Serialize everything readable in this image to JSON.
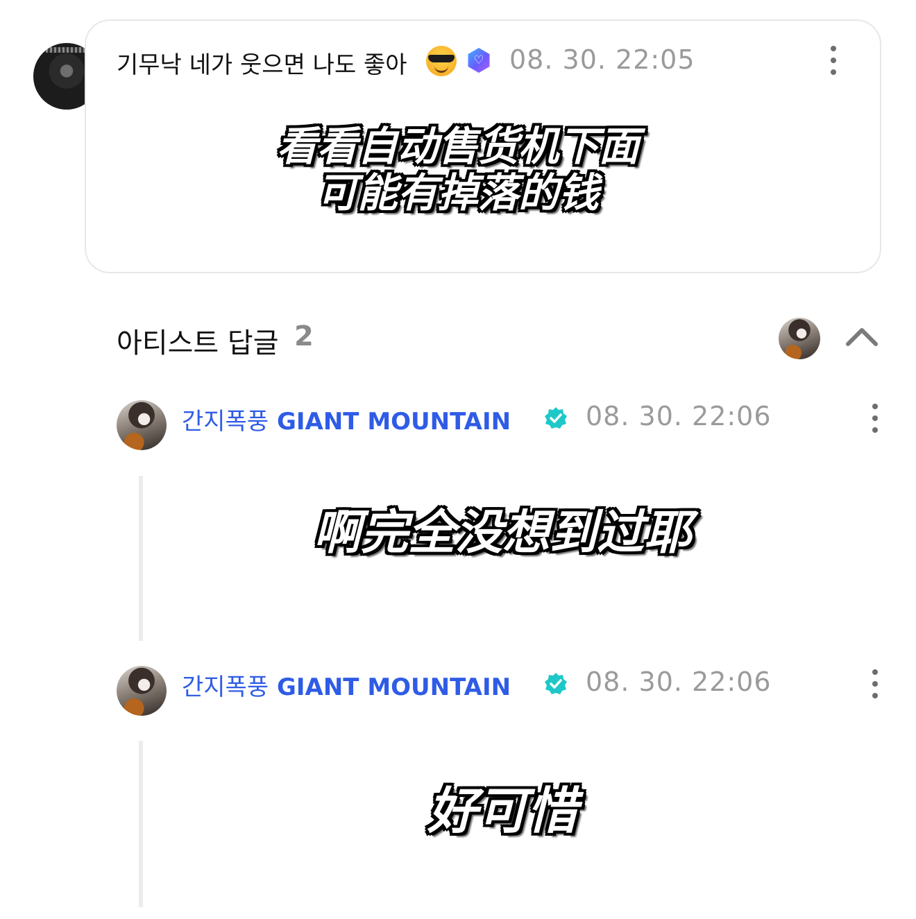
{
  "post": {
    "author": "기무낙 네가 웃으면 나도 좋아",
    "emoji_icon": "smiling-face-with-sunglasses",
    "badge_icon": "fan-verified-hex-badge",
    "timestamp": "08. 30. 22:05",
    "subtitle": "看看自动售货机下面\n可能有掉落的钱"
  },
  "replies_section": {
    "title": "아티스트 답글",
    "count": "2"
  },
  "replies": [
    {
      "author_ko": "간지폭풍",
      "author_en": "GIANT MOUNTAIN",
      "timestamp": "08. 30. 22:06",
      "subtitle": "啊完全没想到过耶"
    },
    {
      "author_ko": "간지폭풍",
      "author_en": "GIANT MOUNTAIN",
      "timestamp": "08. 30. 22:06",
      "subtitle": "好可惜"
    }
  ],
  "colors": {
    "artist_name": "#2f5ce6",
    "verified": "#1ec8c8",
    "timestamp": "#9a9a9a"
  }
}
